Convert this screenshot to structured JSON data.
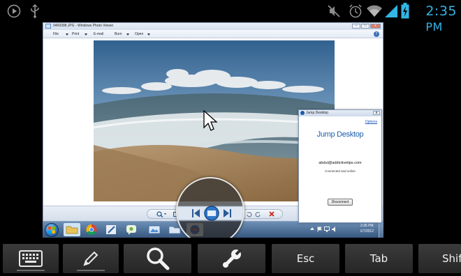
{
  "status_bar": {
    "time": "2:35",
    "time_suffix": "PM",
    "icons": [
      "play-icon",
      "usb-icon",
      "mute-icon",
      "alarm-icon",
      "wifi-icon",
      "signal-icon",
      "battery-charging-icon"
    ],
    "accent_color": "#33b5e5"
  },
  "photo_viewer": {
    "title": "0469398.JPG - Windows Photo Viewer",
    "menu": [
      "File",
      "Print",
      "E-mail",
      "Burn",
      "Open"
    ],
    "help_label": "?"
  },
  "jump_window": {
    "title": "Jump Desktop",
    "options_link": "Options",
    "logo_text": "Jump Desktop",
    "email": "abdul@addictivetips.com",
    "status": "Connected and online",
    "disconnect_label": "Disconnect"
  },
  "taskbar": {
    "clock_time": "2:35 PM",
    "clock_date": "1/7/2012"
  },
  "toolbar": {
    "buttons": [
      {
        "id": "keyboard",
        "icon": "keyboard-icon",
        "label": ""
      },
      {
        "id": "pen",
        "icon": "pen-icon",
        "label": ""
      },
      {
        "id": "zoom",
        "icon": "magnifier-icon",
        "label": ""
      },
      {
        "id": "settings",
        "icon": "wrench-icon",
        "label": ""
      },
      {
        "id": "esc",
        "icon": "",
        "label": "Esc"
      },
      {
        "id": "tab",
        "icon": "",
        "label": "Tab"
      },
      {
        "id": "shift",
        "icon": "",
        "label": "Shift"
      }
    ]
  }
}
